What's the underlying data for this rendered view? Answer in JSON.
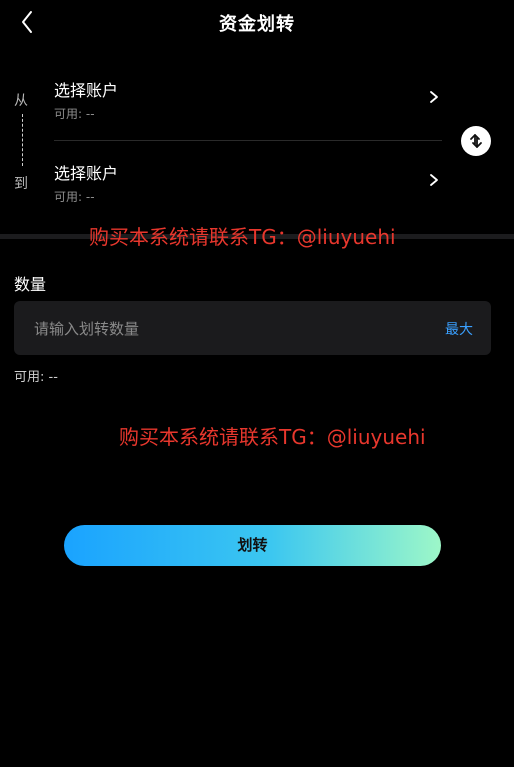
{
  "header": {
    "title": "资金划转",
    "back_icon": "chevron-left-icon"
  },
  "accounts": {
    "from_label": "从",
    "to_label": "到",
    "from": {
      "title": "选择账户",
      "available_label": "可用:",
      "available_value": "--"
    },
    "to": {
      "title": "选择账户",
      "available_label": "可用:",
      "available_value": "--"
    },
    "swap_icon": "swap-vertical-icon"
  },
  "watermarks": [
    "购买本系统请联系TG：@liuyuehi",
    "购买本系统请联系TG：@liuyuehi"
  ],
  "quantity": {
    "label": "数量",
    "placeholder": "请输入划转数量",
    "value": "",
    "max_label": "最大",
    "available_label": "可用:",
    "available_value": "--"
  },
  "submit": {
    "label": "划转"
  },
  "colors": {
    "background": "#000000",
    "accent_blue": "#3aa0ff",
    "watermark_red": "#e8372d",
    "button_gradient_start": "#1aa3ff",
    "button_gradient_end": "#9df7c8"
  }
}
